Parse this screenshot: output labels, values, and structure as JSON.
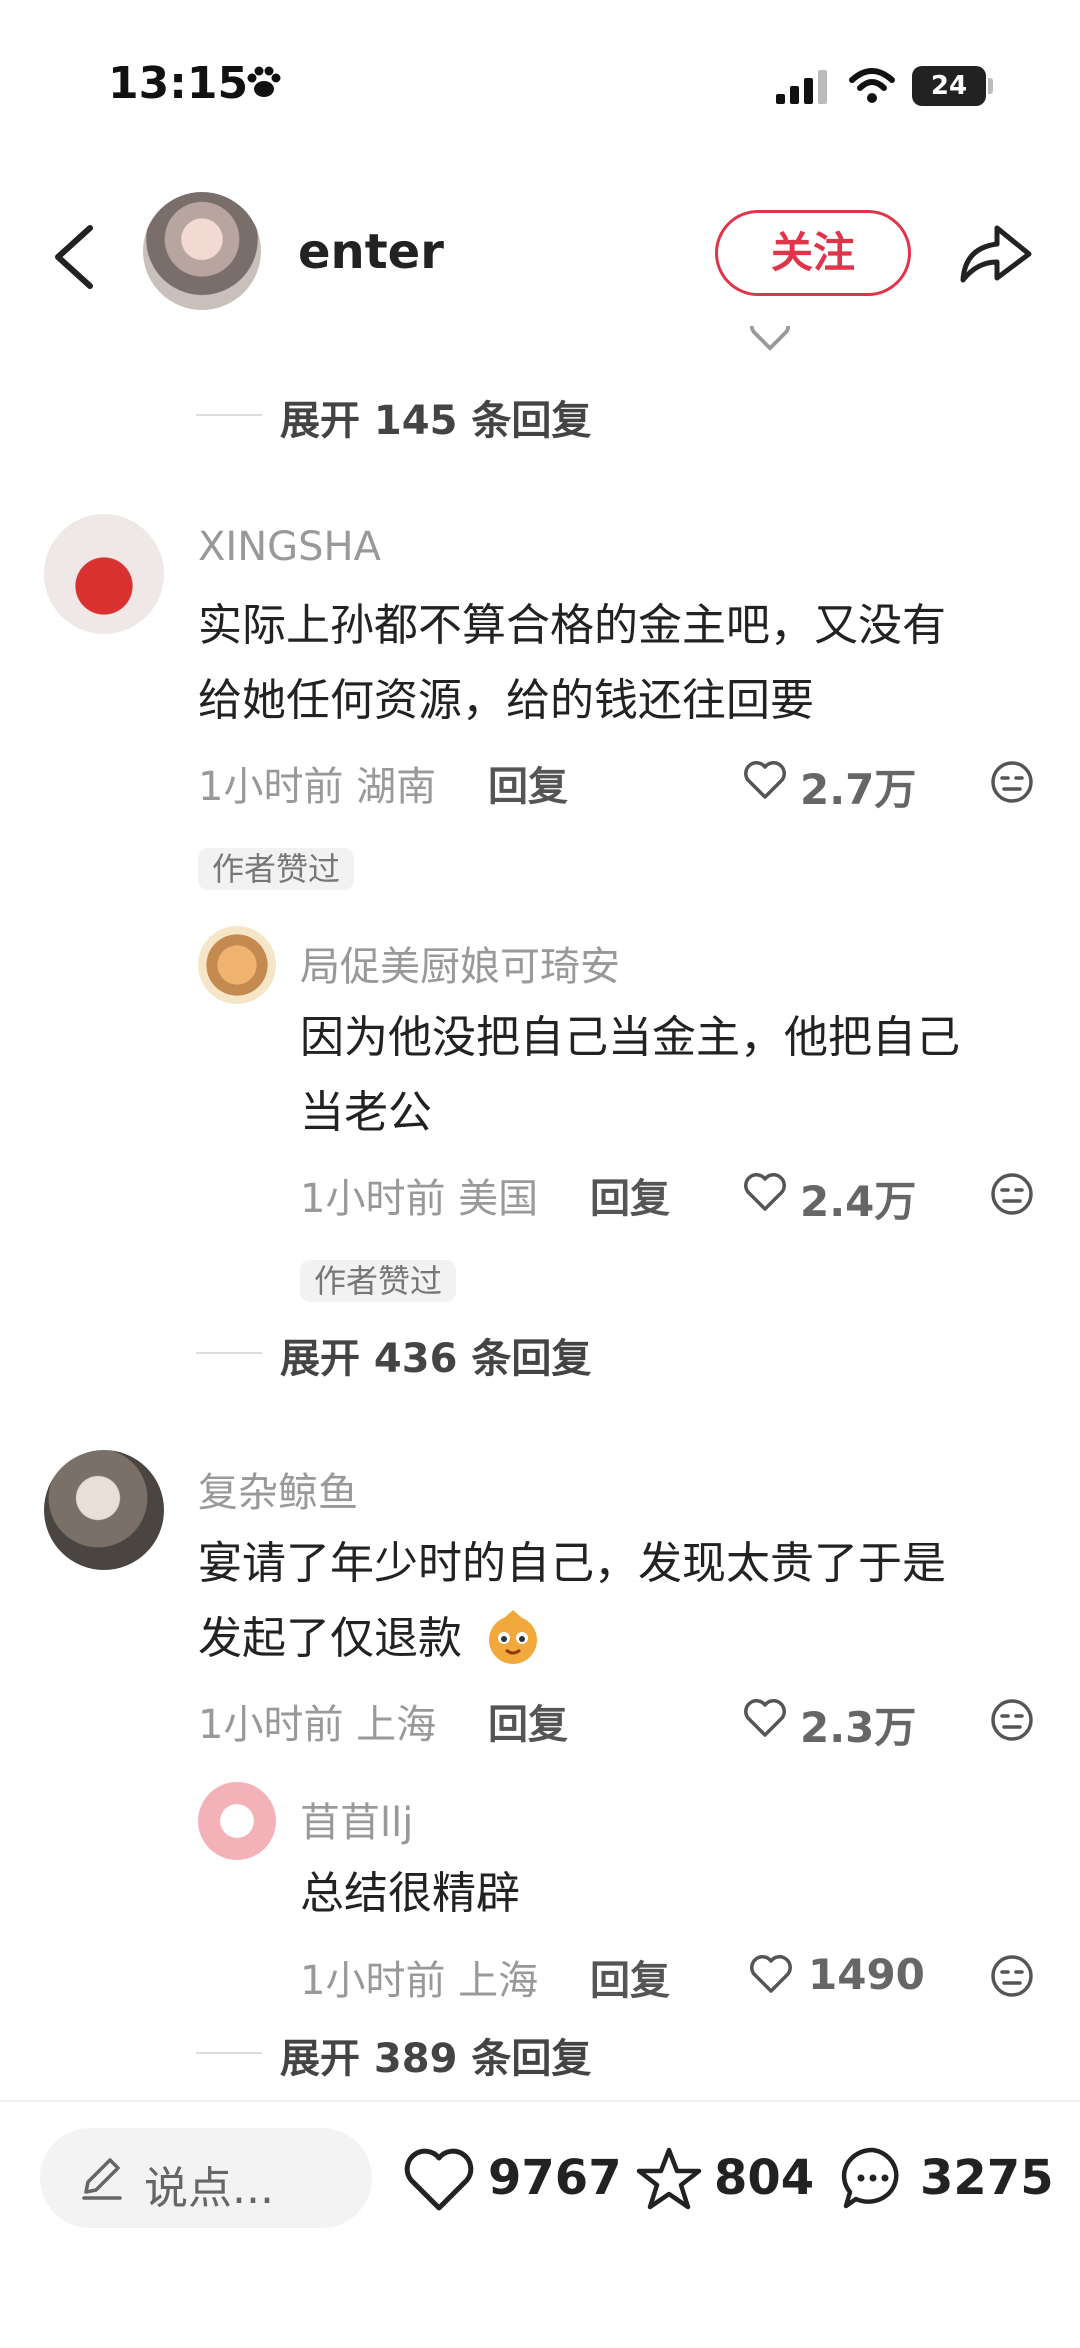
{
  "status_bar": {
    "time": "13:15",
    "battery": "24"
  },
  "header": {
    "author_name": "enter",
    "follow_label": "关注"
  },
  "top_partial": {
    "expand_label": "展开 145 条回复"
  },
  "comments": [
    {
      "name": "XINGSHA",
      "text_line1": "实际上孙都不算合格的金主吧，又没有",
      "text_line2": "给她任何资源，给的钱还往回要",
      "time_location": "1小时前 湖南",
      "reply_label": "回复",
      "likes": "2.7万",
      "badge": "作者赞过",
      "sub_reply": {
        "name": "局促美厨娘可琦安",
        "text_line1": "因为他没把自己当金主，他把自己",
        "text_line2": "当老公",
        "time_location": "1小时前 美国",
        "reply_label": "回复",
        "likes": "2.4万",
        "badge": "作者赞过"
      },
      "expand_label": "展开 436 条回复"
    },
    {
      "name": "复杂鲸鱼",
      "text_line1": "宴请了年少时的自己，发现太贵了于是",
      "text_line2": "发起了仅退款",
      "time_location": "1小时前 上海",
      "reply_label": "回复",
      "likes": "2.3万",
      "sub_reply": {
        "name": "苜苜llj",
        "text_line1": "总结很精辟",
        "time_location": "1小时前 上海",
        "reply_label": "回复",
        "likes": "1490"
      },
      "expand_label": "展开 389 条回复"
    }
  ],
  "bottom_bar": {
    "input_placeholder": "说点...",
    "like_count": "9767",
    "favorite_count": "804",
    "comment_count": "3275"
  }
}
